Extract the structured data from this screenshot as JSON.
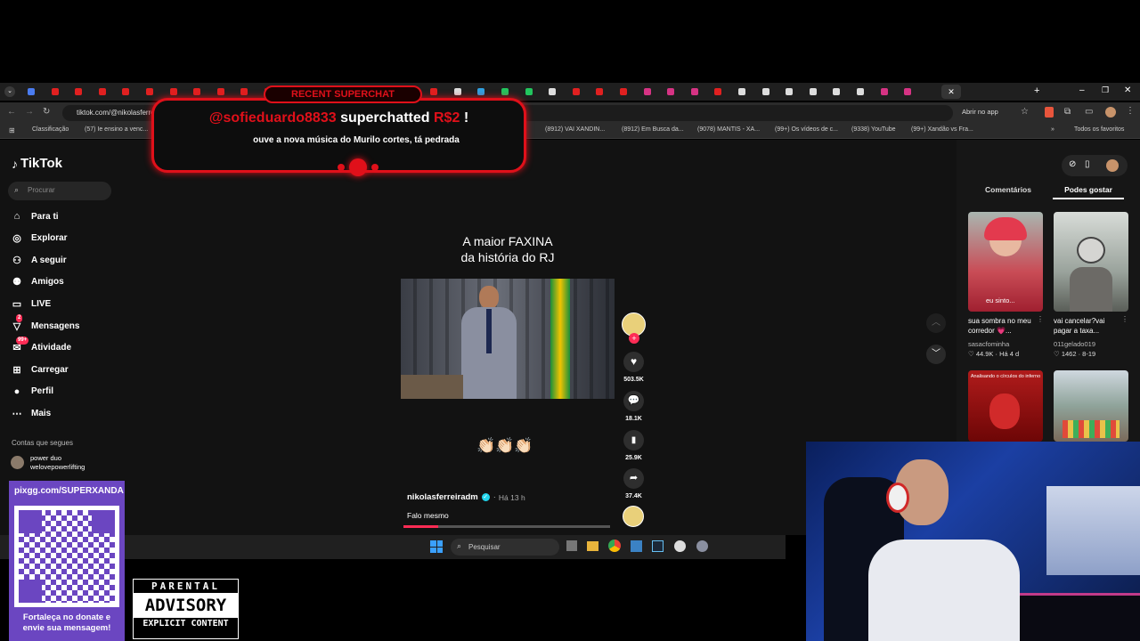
{
  "browser": {
    "url": "tiktok.com/@nikolasferreiradm",
    "open_app": "Abrir no app",
    "bookmarks": [
      "Classificação",
      "(57) Ie ensino a venc...",
      "(8912) VAI XANDIN...",
      "(8912) Em Busca da...",
      "(9078) MANTIS - XA...",
      "(99+) Os vídeos de c...",
      "(9338) YouTube",
      "(99+) Xandão vs Fra..."
    ],
    "all_favorites": "Todos os favoritos"
  },
  "tiktok": {
    "brand": "TikTok",
    "search_placeholder": "Procurar",
    "nav": [
      {
        "label": "Para ti",
        "icon": "home-icon"
      },
      {
        "label": "Explorar",
        "icon": "compass-icon"
      },
      {
        "label": "A seguir",
        "icon": "user-follow-icon"
      },
      {
        "label": "Amigos",
        "icon": "friends-icon"
      },
      {
        "label": "LIVE",
        "icon": "live-icon"
      },
      {
        "label": "Mensagens",
        "icon": "messages-icon",
        "badge": "2"
      },
      {
        "label": "Atividade",
        "icon": "activity-icon",
        "badge": "99+"
      },
      {
        "label": "Carregar",
        "icon": "upload-icon"
      },
      {
        "label": "Perfil",
        "icon": "profile-icon"
      },
      {
        "label": "Mais",
        "icon": "more-icon"
      }
    ],
    "following_heading": "Contas que segues",
    "following_name": "power duo",
    "following_handle": "welovepowerlifting",
    "video": {
      "caption_line1": "A maior FAXINA",
      "caption_line2": "da história do RJ",
      "emojis": "👏🏻👏🏻👏🏻",
      "author": "nikolasferreiradm",
      "time": "Há 13 h",
      "description": "Falo mesmo",
      "likes": "503.5K",
      "comments": "18.1K",
      "saves": "25.9K",
      "shares": "37.4K",
      "progress": 0.17
    },
    "tabs": {
      "comments": "Comentários",
      "suggested": "Podes gostar"
    },
    "suggestions": [
      {
        "title": "sua sombra no meu corredor 💗...",
        "author": "sasacfominha",
        "stats": "44.9K · Há 4 d",
        "overlay": "eu sinto..."
      },
      {
        "title": "vai cancelar?vai pagar a taxa...",
        "author": "011gelado019",
        "stats": "1462 · 8-19",
        "overlay": ""
      },
      {
        "title": "",
        "author": "",
        "stats": "",
        "overlay": "Analisando o círculos do inferno"
      },
      {
        "title": "",
        "author": "",
        "stats": "",
        "overlay": ""
      }
    ]
  },
  "taskbar": {
    "search": "Pesquisar"
  },
  "superchat": {
    "header": "RECENT SUPERCHAT",
    "user": "@sofieduardo8833",
    "action": "superchatted",
    "amount": "R$2",
    "bang": "!",
    "message": "ouve a nova música do Murilo cortes, tá pedrada"
  },
  "overlay": {
    "donate_url": "pixgg.com/SUPERXANDA",
    "donate_text": "Fortaleça no donate e envie sua mensagem!",
    "pa_line1": "PARENTAL",
    "pa_line2": "ADVISORY",
    "pa_line3": "EXPLICIT CONTENT"
  },
  "colors": {
    "accent": "#fe2c55",
    "superchat_red": "#e0101a"
  }
}
